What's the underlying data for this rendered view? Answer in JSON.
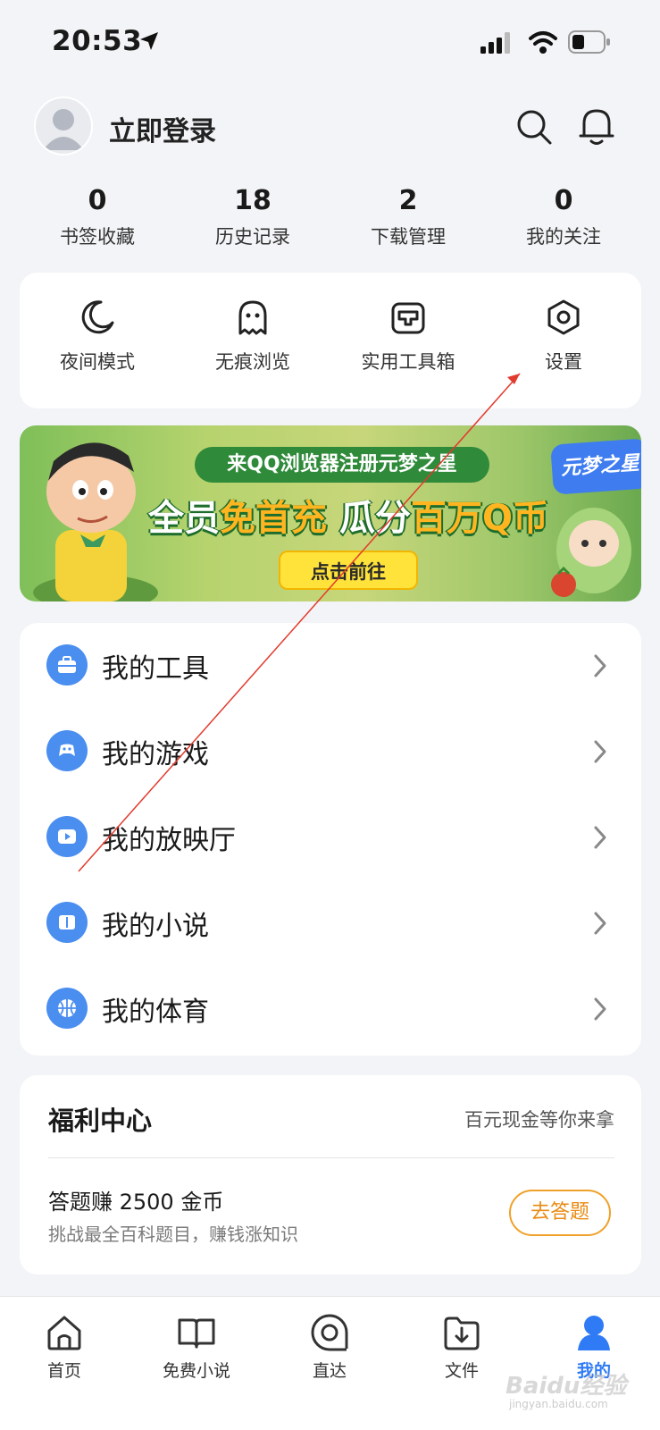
{
  "status_bar": {
    "time": "20:53"
  },
  "header": {
    "login_text": "立即登录"
  },
  "stats": [
    {
      "value": "0",
      "label": "书签收藏"
    },
    {
      "value": "18",
      "label": "历史记录"
    },
    {
      "value": "2",
      "label": "下载管理"
    },
    {
      "value": "0",
      "label": "我的关注"
    }
  ],
  "quick_actions": [
    {
      "label": "夜间模式",
      "icon": "moon-icon"
    },
    {
      "label": "无痕浏览",
      "icon": "ghost-icon"
    },
    {
      "label": "实用工具箱",
      "icon": "toolbox-icon"
    },
    {
      "label": "设置",
      "icon": "settings-icon"
    }
  ],
  "banner": {
    "top_line": "来QQ浏览器注册元梦之星",
    "main_part1": "全员",
    "main_highlight": "免首充",
    "main_part2": " 瓜分",
    "main_highlight2": "百万Q币",
    "button": "点击前往",
    "logo": "元梦之星"
  },
  "menu": [
    {
      "label": "我的工具",
      "icon": "briefcase-icon"
    },
    {
      "label": "我的游戏",
      "icon": "gamepad-icon"
    },
    {
      "label": "我的放映厅",
      "icon": "play-icon"
    },
    {
      "label": "我的小说",
      "icon": "book-icon"
    },
    {
      "label": "我的体育",
      "icon": "basketball-icon"
    }
  ],
  "welfare": {
    "title": "福利中心",
    "subtitle": "百元现金等你来拿",
    "quiz_title": "答题赚 2500 金币",
    "quiz_desc": "挑战最全百科题目，赚钱涨知识",
    "quiz_button": "去答题"
  },
  "tabbar": [
    {
      "label": "首页",
      "icon": "home-icon"
    },
    {
      "label": "免费小说",
      "icon": "open-book-icon"
    },
    {
      "label": "直达",
      "icon": "direct-icon"
    },
    {
      "label": "文件",
      "icon": "file-download-icon"
    },
    {
      "label": "我的",
      "icon": "user-icon",
      "active": true
    }
  ],
  "watermark": {
    "brand": "Baidu经验",
    "domain": "jingyan.baidu.com"
  },
  "colors": {
    "accent": "#2f7bf5",
    "menu_icon_bg": "#4a8ef0",
    "quiz_button": "#f0a12a",
    "annotation": "#e23a2e"
  }
}
